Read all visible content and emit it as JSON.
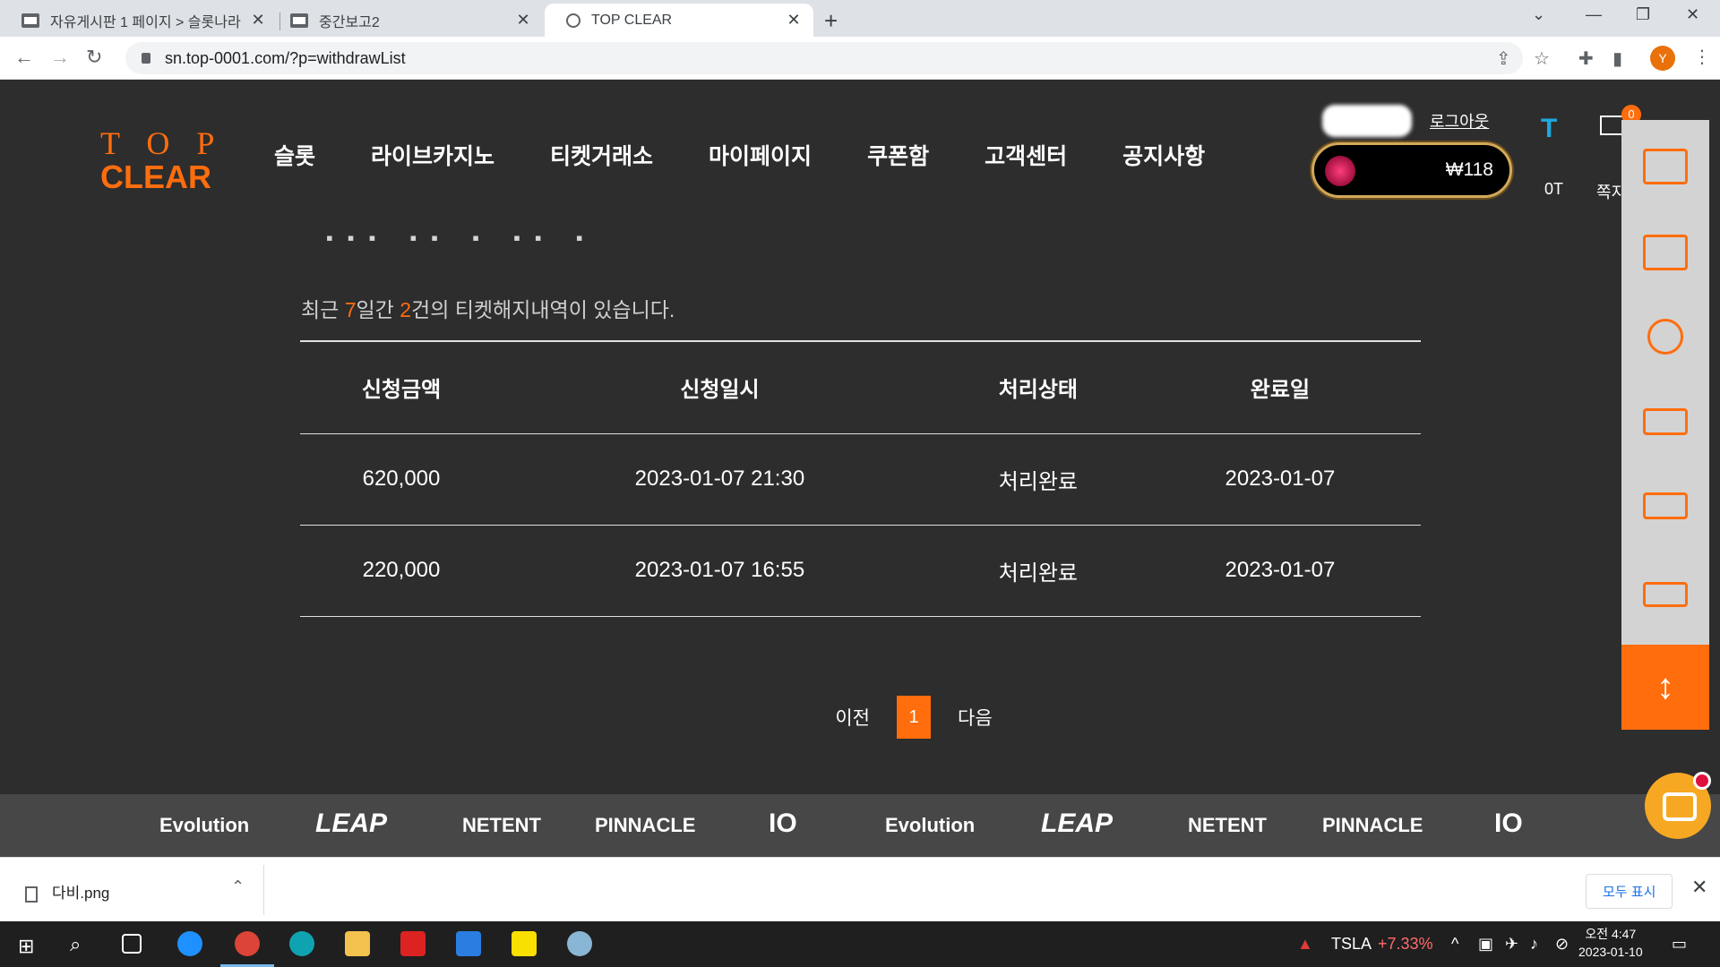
{
  "browser": {
    "tabs": [
      {
        "title": "자유게시판 1 페이지 > 슬롯나라",
        "active": false
      },
      {
        "title": "중간보고2",
        "active": false
      },
      {
        "title": "TOP CLEAR",
        "active": true
      }
    ],
    "url": "sn.top-0001.com/?p=withdrawList",
    "profile_initial": "Y"
  },
  "site": {
    "logo_top": "TOP",
    "logo_bottom": "CLEAR",
    "nav": [
      "슬롯",
      "라이브카지노",
      "티켓거래소",
      "마이페이지",
      "쿠폰함",
      "고객센터",
      "공지사항"
    ],
    "logout_label": "로그아웃",
    "balance": "₩118",
    "t_label": "0T",
    "mail_badge": "0",
    "mail_label": "쪽지"
  },
  "main": {
    "summary_prefix": "최근 ",
    "summary_days": "7",
    "summary_mid": "일간 ",
    "summary_count": "2",
    "summary_suffix": "건의 티켓해지내역이 있습니다.",
    "columns": [
      "신청금액",
      "신청일시",
      "처리상태",
      "완료일"
    ],
    "rows": [
      {
        "amount": "620,000",
        "requested": "2023-01-07 21:30",
        "status": "처리완료",
        "completed": "2023-01-07"
      },
      {
        "amount": "220,000",
        "requested": "2023-01-07 16:55",
        "status": "처리완료",
        "completed": "2023-01-07"
      }
    ],
    "pager": {
      "prev": "이전",
      "current": "1",
      "next": "다음"
    }
  },
  "providers": [
    "Evolution",
    "LEAP",
    "NETENT",
    "PINNACLE",
    "IO",
    "Evolution",
    "LEAP",
    "NETENT",
    "PINNACLE",
    "IO"
  ],
  "download_bar": {
    "file": "다비.png",
    "show_all": "모두 표시"
  },
  "taskbar": {
    "stock_symbol": "TSLA",
    "stock_change": "+7.33%",
    "time": "오전 4:47",
    "date": "2023-01-10"
  },
  "colors": {
    "accent": "#ff6d0d",
    "page_bg": "#2d2d2d"
  }
}
